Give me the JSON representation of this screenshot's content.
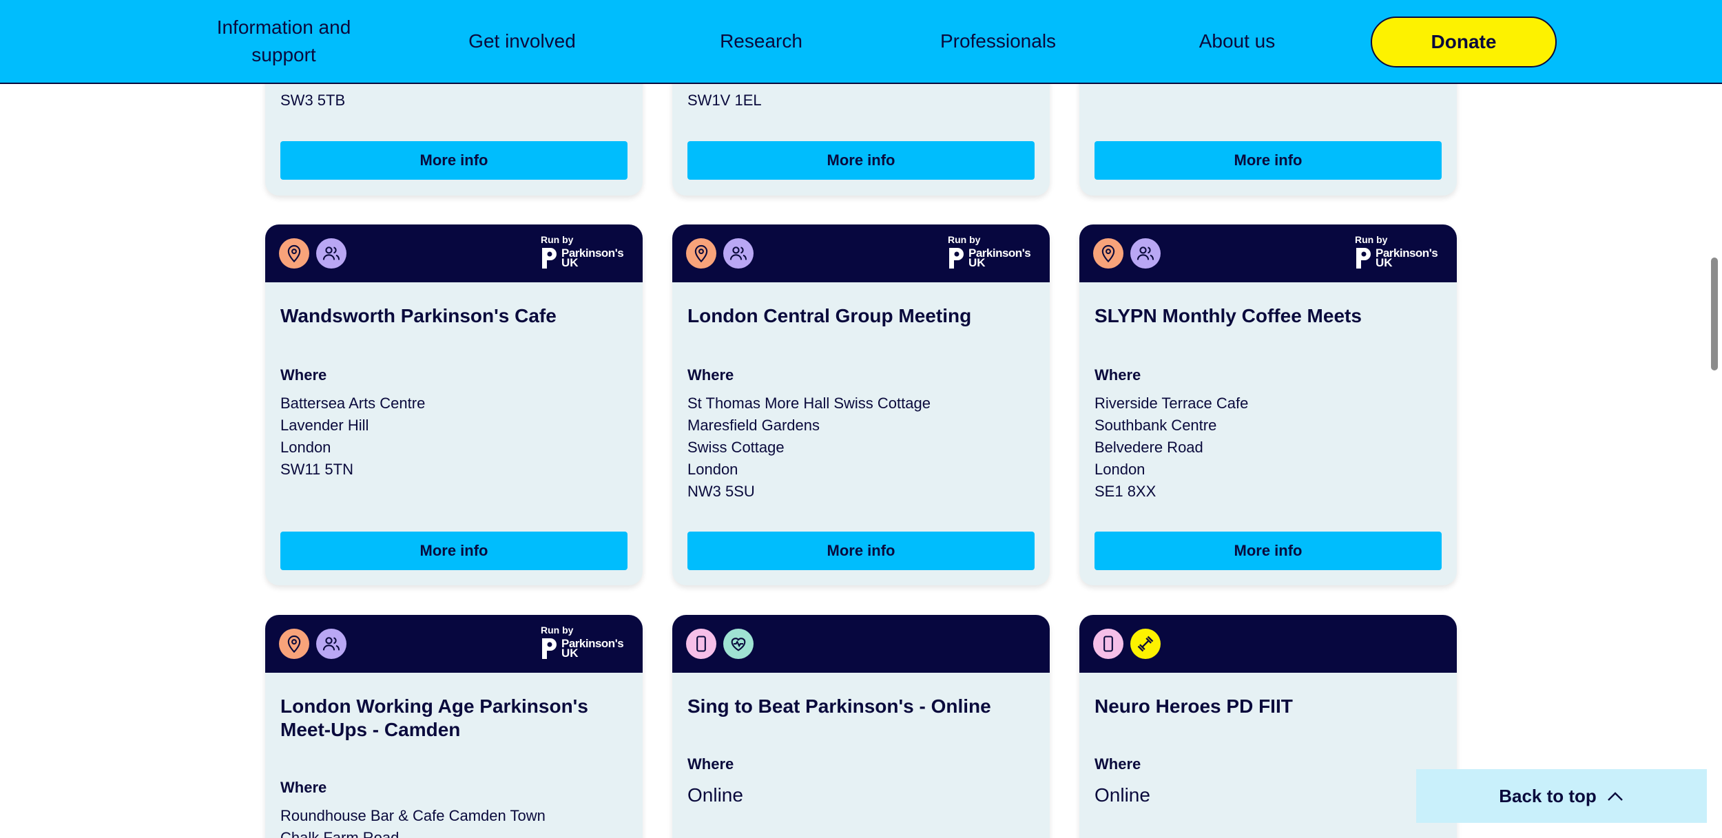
{
  "nav": {
    "items": [
      {
        "label": "Information and support"
      },
      {
        "label": "Get involved"
      },
      {
        "label": "Research"
      },
      {
        "label": "Professionals"
      },
      {
        "label": "About us"
      }
    ],
    "donate_label": "Donate"
  },
  "runby": {
    "label": "Run by",
    "name": "Parkinson's",
    "uk": "UK"
  },
  "where_label": "Where",
  "more_info_label": "More info",
  "top_row": [
    {
      "last_line": "SW3 5TB"
    },
    {
      "last_line": "SW1V 1EL"
    },
    {
      "last_line": ""
    }
  ],
  "cards": [
    {
      "title": "Wandsworth Parkinson's Cafe",
      "icons": [
        "location-pin-icon",
        "people-group-icon"
      ],
      "address": [
        "Battersea Arts Centre",
        "Lavender Hill",
        "London",
        "SW11 5TN"
      ]
    },
    {
      "title": "London Central Group Meeting",
      "icons": [
        "location-pin-icon",
        "people-group-icon"
      ],
      "address": [
        "St Thomas More Hall Swiss Cottage",
        "Maresfield Gardens",
        "Swiss Cottage",
        "London",
        "NW3 5SU"
      ]
    },
    {
      "title": "SLYPN Monthly Coffee Meets",
      "icons": [
        "location-pin-icon",
        "people-group-icon"
      ],
      "address": [
        "Riverside Terrace Cafe",
        "Southbank Centre",
        "Belvedere Road",
        "London",
        "SE1 8XX"
      ]
    },
    {
      "title": "London Working Age Parkinson's Meet-Ups - Camden",
      "icons": [
        "location-pin-icon",
        "people-group-icon"
      ],
      "address": [
        "Roundhouse Bar & Cafe Camden Town",
        "Chalk Farm Road"
      ]
    },
    {
      "title": "Sing to Beat Parkinson's - Online",
      "icons": [
        "mobile-phone-icon",
        "heart-pulse-icon"
      ],
      "address": [
        "Online"
      ]
    },
    {
      "title": "Neuro Heroes PD FIIT",
      "icons": [
        "mobile-phone-icon",
        "dumbbell-icon"
      ],
      "address": [
        "Online"
      ]
    }
  ],
  "back_to_top_label": "Back to top",
  "colors": {
    "nav_bg": "#00bdfd",
    "donate_bg": "#fdf200",
    "card_head_bg": "#07073f",
    "card_bg": "#e6f1f4",
    "button_bg": "#00bdfd",
    "text": "#0a0a3c"
  }
}
